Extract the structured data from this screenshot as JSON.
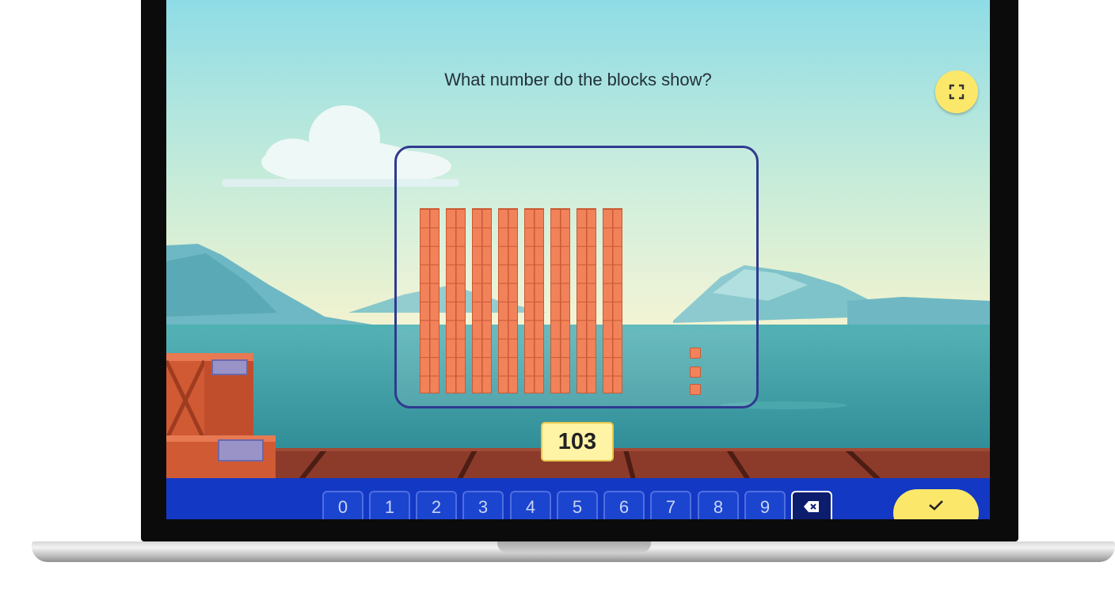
{
  "question": {
    "text": "What number do the blocks show?"
  },
  "blocks": {
    "tens": 8,
    "ones": 3
  },
  "answer": {
    "value": "103"
  },
  "keypad": {
    "keys": [
      "0",
      "1",
      "2",
      "3",
      "4",
      "5",
      "6",
      "7",
      "8",
      "9"
    ],
    "backspace_icon": "backspace-icon"
  },
  "controls": {
    "fullscreen_icon": "fullscreen-icon",
    "submit_icon": "checkmark-icon"
  },
  "colors": {
    "sky_top": "#8fdce6",
    "sea": "#3f9fa7",
    "block_fill": "#f2825a",
    "panel_border": "#2f3a8f",
    "keypad_bar": "#1338c4",
    "accent_yellow": "#fbe86a"
  }
}
